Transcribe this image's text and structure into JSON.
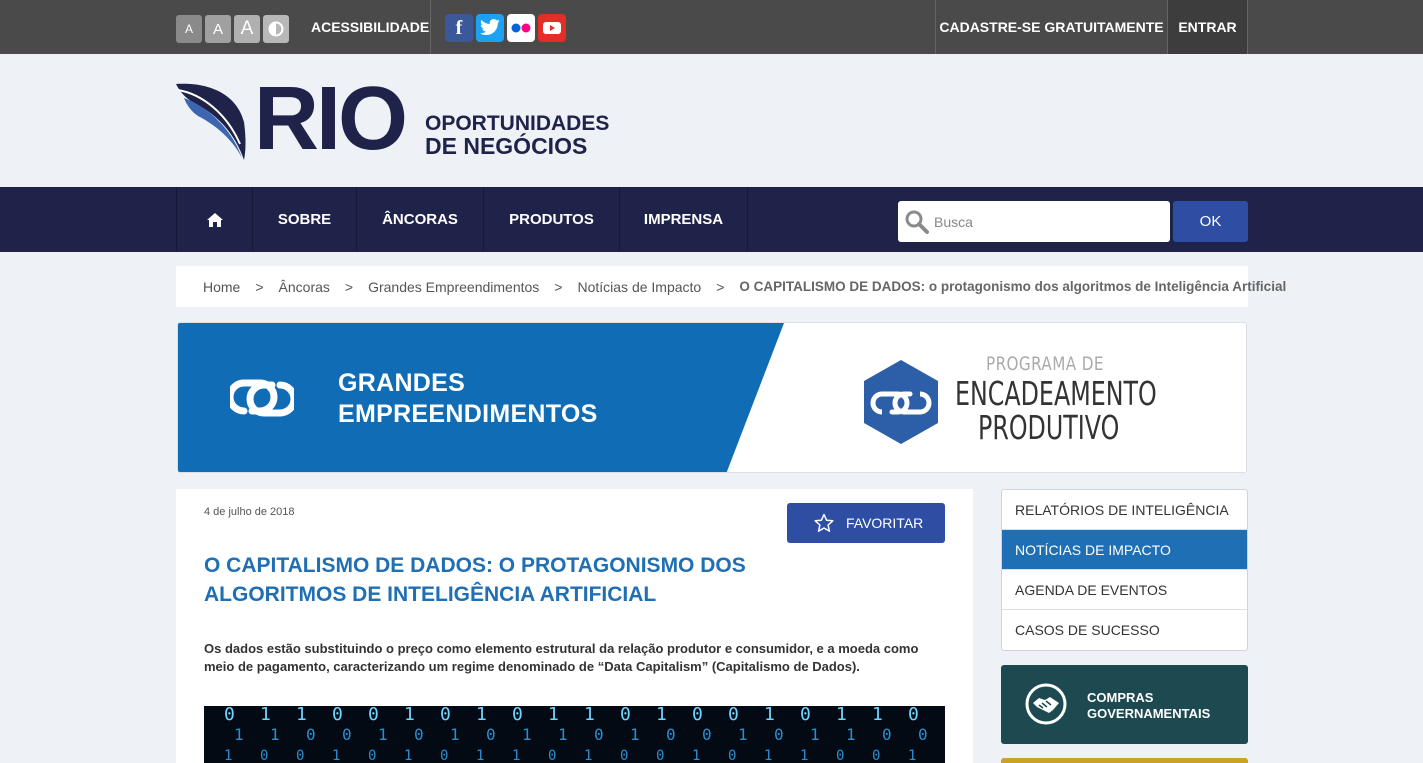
{
  "topbar": {
    "font_small": "A",
    "font_medium": "A",
    "font_large": "A",
    "accessibility_label": "ACESSIBILIDADE",
    "social": {
      "facebook": "f"
    },
    "register_label": "CADASTRE-SE GRATUITAMENTE",
    "login_label": "ENTRAR"
  },
  "header": {
    "logo_main": "RIO",
    "logo_line1": "OPORTUNIDADES",
    "logo_line2": "DE NEGÓCIOS"
  },
  "nav": {
    "items": [
      {
        "label": "SOBRE"
      },
      {
        "label": "ÂNCORAS"
      },
      {
        "label": "PRODUTOS"
      },
      {
        "label": "IMPRENSA"
      }
    ],
    "search_placeholder": "Busca",
    "search_button": "OK"
  },
  "breadcrumb": {
    "items": [
      "Home",
      "Âncoras",
      "Grandes Empreendimentos",
      "Notícias de Impacto"
    ],
    "separator": ">",
    "current": "O CAPITALISMO DE DADOS: o protagonismo dos algoritmos de Inteligência Artificial"
  },
  "banner": {
    "title_line1": "GRANDES",
    "title_line2": "EMPREENDIMENTOS",
    "program_line1": "PROGRAMA DE",
    "program_line2": "ENCADEAMENTO",
    "program_line3": "PRODUTIVO",
    "colors": {
      "blue": "#0f6cb5",
      "hex": "#2d5fa8"
    }
  },
  "article": {
    "date": "4 de julho de 2018",
    "favorite_label": "FAVORITAR",
    "title_line1": "O CAPITALISMO DE DADOS: O PROTAGONISMO DOS",
    "title_line2": "ALGORITMOS DE INTELIGÊNCIA ARTIFICIAL",
    "lead": "Os dados estão substituindo o preço como elemento estrutural da relação produtor e consumidor, e a moeda como meio de pagamento, caracterizando um regime denominado de “Data Capitalism” (Capitalismo de Dados).",
    "image_digits": [
      "0",
      "1",
      "1",
      "0",
      "0",
      "1",
      "0",
      "1",
      "0",
      "1",
      "1",
      "0",
      "1",
      "0",
      "0",
      "1",
      "0",
      "1",
      "1",
      "0"
    ]
  },
  "sidebar": {
    "menu": [
      {
        "label": "RELATÓRIOS DE INTELIGÊNCIA",
        "active": false
      },
      {
        "label": "NOTÍCIAS DE IMPACTO",
        "active": true
      },
      {
        "label": "AGENDA DE EVENTOS",
        "active": false
      },
      {
        "label": "CASOS DE SUCESSO",
        "active": false
      }
    ],
    "promo_line1": "COMPRAS",
    "promo_line2": "GOVERNAMENTAIS"
  },
  "theme": {
    "navy": "#1f2349",
    "accent_blue": "#1f6fb5",
    "button_blue": "#2d4ea2",
    "promo_teal": "#1d4a50"
  }
}
